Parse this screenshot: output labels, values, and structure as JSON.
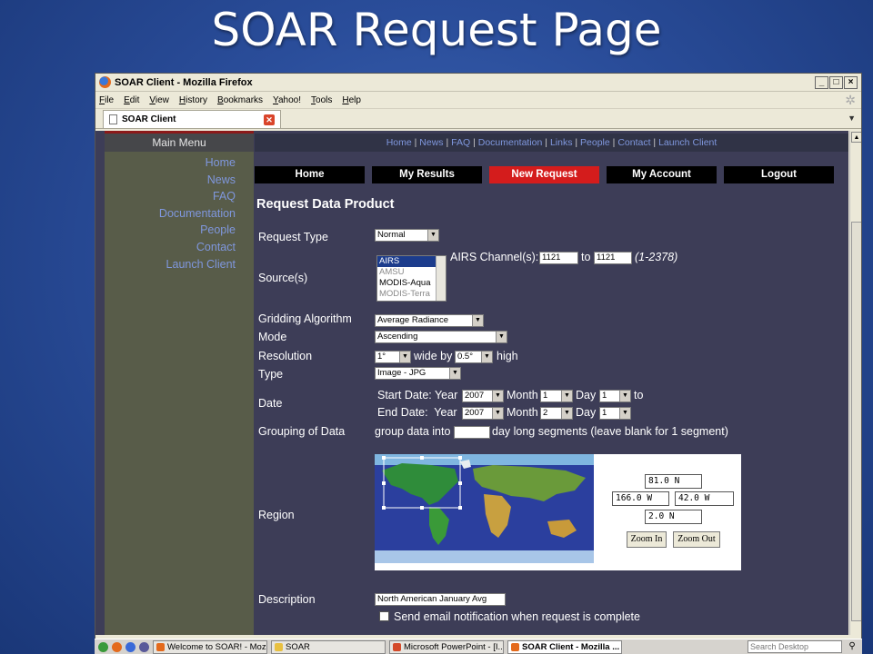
{
  "slide": {
    "title": "SOAR Request Page"
  },
  "browser": {
    "window_title": "SOAR Client - Mozilla Firefox",
    "menu": [
      "File",
      "Edit",
      "View",
      "History",
      "Bookmarks",
      "Yahoo!",
      "Tools",
      "Help"
    ],
    "tab_title": "SOAR Client"
  },
  "sidebar": {
    "header": "Main Menu",
    "links": [
      "Home",
      "News",
      "FAQ",
      "Documentation",
      "People",
      "Contact",
      "Launch Client"
    ]
  },
  "topnav": {
    "links": [
      "Home",
      "News",
      "FAQ",
      "Documentation",
      "Links",
      "People",
      "Contact",
      "Launch Client"
    ],
    "separator": "|"
  },
  "navbuttons": [
    {
      "label": "Home",
      "active": false
    },
    {
      "label": "My Results",
      "active": false
    },
    {
      "label": "New Request",
      "active": true
    },
    {
      "label": "My Account",
      "active": false
    },
    {
      "label": "Logout",
      "active": false
    }
  ],
  "form": {
    "heading": "Request Data Product",
    "request_type": {
      "label": "Request Type",
      "value": "Normal"
    },
    "sources": {
      "label": "Source(s)",
      "options": [
        "AIRS",
        "AMSU",
        "MODIS-Aqua",
        "MODIS-Terra"
      ],
      "selected": "AIRS",
      "channel_label": "AIRS Channel(s):",
      "channel_from": "1121",
      "channel_to_word": "to",
      "channel_to": "1121",
      "channel_range": "(1-2378)"
    },
    "gridding": {
      "label": "Gridding Algorithm",
      "value": "Average Radiance"
    },
    "mode": {
      "label": "Mode",
      "value": "Ascending"
    },
    "resolution": {
      "label": "Resolution",
      "width": "1°",
      "wide_by": "wide by",
      "height": "0.5°",
      "high": "high"
    },
    "type": {
      "label": "Type",
      "value": "Image - JPG"
    },
    "date": {
      "label": "Date",
      "start_label": "Start Date: Year",
      "end_label": "End Date:  Year",
      "month_label": "Month",
      "day_label": "Day",
      "to_label": "to",
      "start": {
        "year": "2007",
        "month": "1",
        "day": "1"
      },
      "end": {
        "year": "2007",
        "month": "2",
        "day": "1"
      }
    },
    "grouping": {
      "label": "Grouping of Data",
      "prefix": "group data into",
      "value": "",
      "suffix": "day long segments (leave blank for 1 segment)"
    },
    "region": {
      "label": "Region",
      "north": "81.0 N",
      "west": "166.0 W",
      "east": "42.0 W",
      "south": "2.0 N",
      "zoom_in": "Zoom In",
      "zoom_out": "Zoom Out"
    },
    "description": {
      "label": "Description",
      "value": "North American January Avg"
    },
    "email": {
      "label": "Send email notification when request is complete",
      "checked": false
    }
  },
  "taskbar": {
    "items": [
      {
        "label": "Welcome to SOAR! - Moz...",
        "active": false
      },
      {
        "label": "SOAR",
        "active": false
      },
      {
        "label": "Microsoft PowerPoint - [I...",
        "active": false
      },
      {
        "label": "SOAR Client - Mozilla ...",
        "active": true
      }
    ],
    "search_placeholder": "Search Desktop"
  },
  "colors": {
    "slide_bg": "#2a4d9a",
    "page_bg": "#3d3d57",
    "sidebar_bg": "#585c49",
    "link": "#7f97dd",
    "active_button": "#d41c1c"
  }
}
